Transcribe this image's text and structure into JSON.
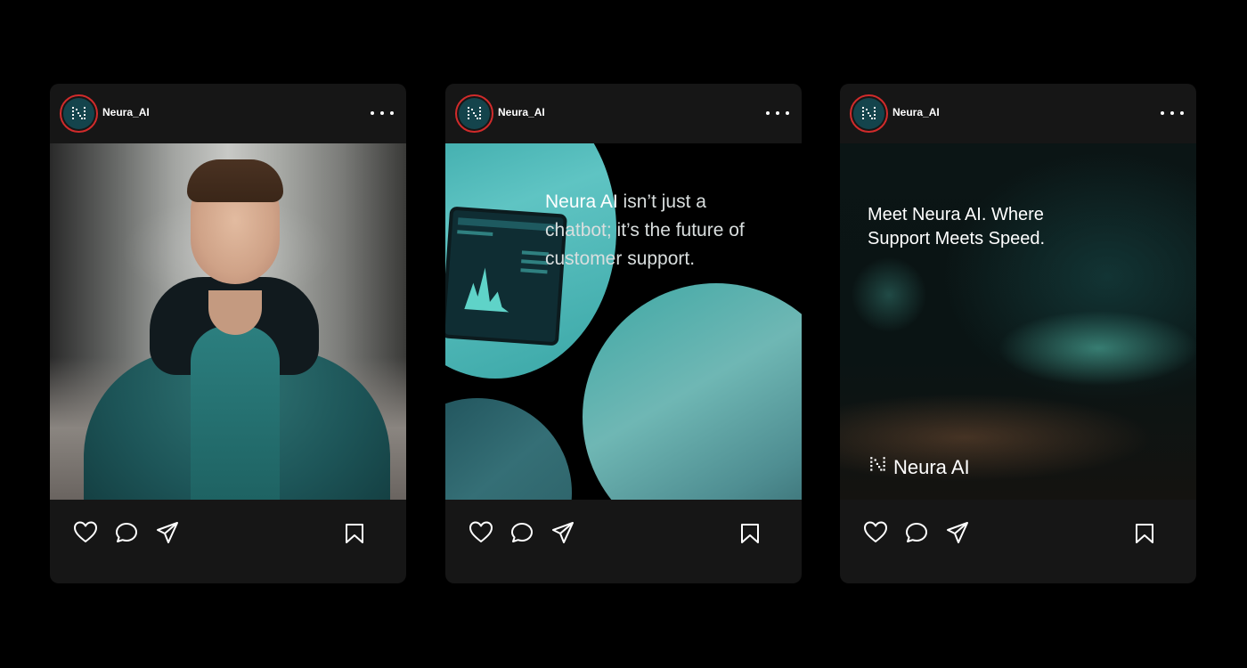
{
  "colors": {
    "background": "#000000",
    "card": "#161616",
    "avatar_ring": "#d12b2b",
    "avatar_fill": "#14444c",
    "accent_teal": "#2b9d9e"
  },
  "posts": [
    {
      "username": "Neura_AI",
      "more_icon": "more-horizontal-icon",
      "media_description": "portrait photo"
    },
    {
      "username": "Neura_AI",
      "more_icon": "more-horizontal-icon",
      "overlay_highlight": "Neura AI",
      "overlay_text": " isn’t just a chatbot; it’s the future of customer support."
    },
    {
      "username": "Neura_AI",
      "more_icon": "more-horizontal-icon",
      "overlay_title": "Meet Neura AI. Where Support Meets Speed.",
      "logo_text": "Neura AI"
    }
  ],
  "actions": {
    "like_icon": "heart-icon",
    "comment_icon": "comment-icon",
    "share_icon": "send-icon",
    "save_icon": "bookmark-icon"
  }
}
